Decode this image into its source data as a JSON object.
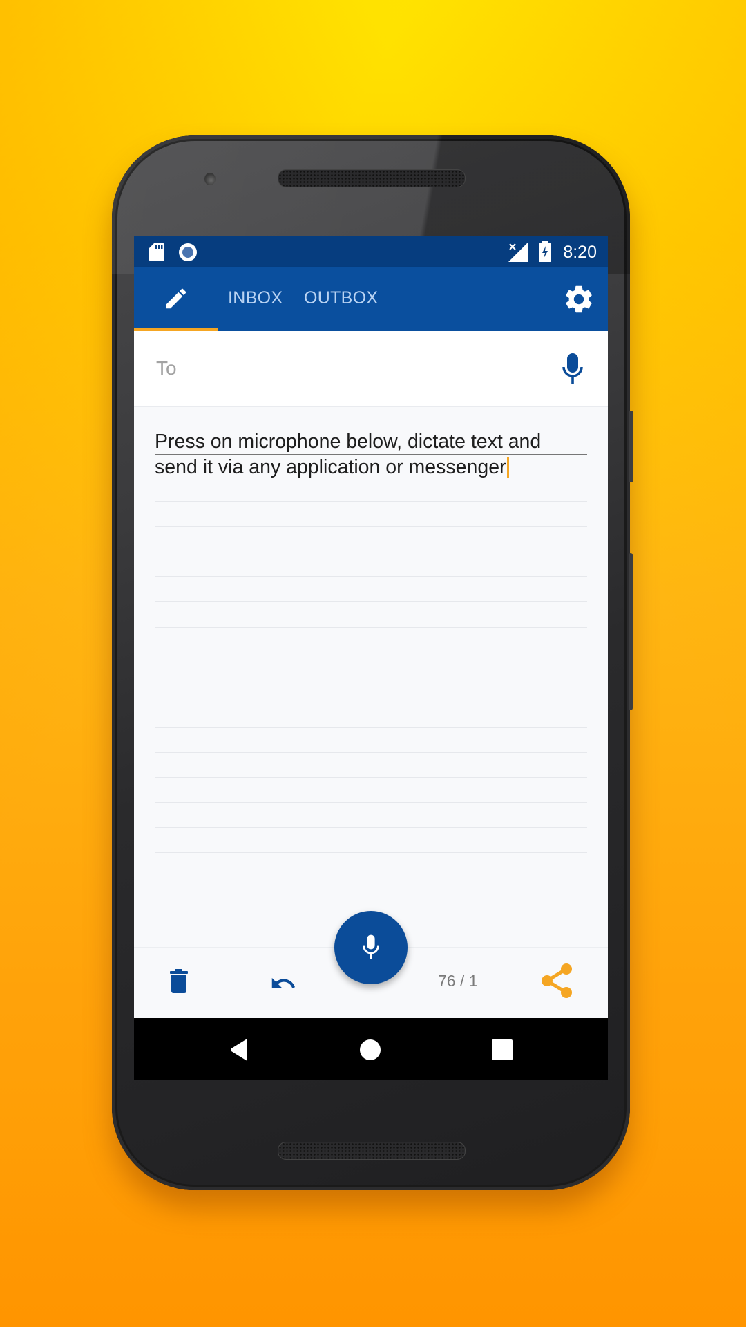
{
  "colors": {
    "status_bar": "#063d7f",
    "app_bar": "#0a4f9e",
    "accent": "#f5a623",
    "primary_icon": "#0b4c99",
    "tab_text": "#b9d3f3"
  },
  "status_bar": {
    "left_icons": [
      "sd-card-icon",
      "record-icon"
    ],
    "right_icons": [
      "no-signal-icon",
      "battery-charging-icon"
    ],
    "time": "8:20"
  },
  "app_bar": {
    "tabs": [
      {
        "id": "compose",
        "icon": "pencil-icon",
        "label": "",
        "active": true
      },
      {
        "id": "inbox",
        "label": "INBOX",
        "active": false
      },
      {
        "id": "outbox",
        "label": "OUTBOX",
        "active": false
      }
    ],
    "settings_icon": "gear-icon"
  },
  "to_field": {
    "placeholder": "To",
    "value": "",
    "mic_icon": "microphone-icon"
  },
  "note": {
    "lines": [
      "Press on microphone below, dictate text and",
      "send it via any application or messenger"
    ]
  },
  "bottom_bar": {
    "delete_icon": "trash-icon",
    "undo_icon": "undo-icon",
    "fab_icon": "microphone-icon",
    "counter": "76 / 1",
    "share_icon": "share-icon"
  },
  "nav_bar": {
    "back": "back-icon",
    "home": "home-icon",
    "recents": "recents-icon"
  }
}
